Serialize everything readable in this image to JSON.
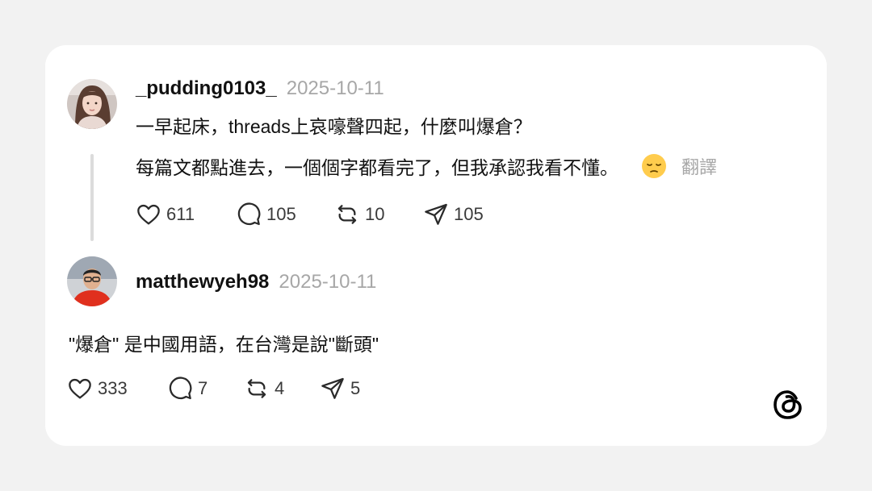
{
  "post1": {
    "username": "_pudding0103_",
    "timestamp": "2025-10-11",
    "line1": "一早起床，threads上哀嚎聲四起，什麼叫爆倉？",
    "line2": "每篇文都點進去，一個個字都看完了，但我承認我看不懂。",
    "emoji_icon": "pensive-face-icon",
    "translate_label": "翻譯",
    "likes": "611",
    "replies": "105",
    "reposts": "10",
    "shares": "105"
  },
  "post2": {
    "username": "matthewyeh98",
    "timestamp": "2025-10-11",
    "text": "\"爆倉\" 是中國用語，在台灣是說\"斷頭\"",
    "likes": "333",
    "replies": "7",
    "reposts": "4",
    "shares": "5"
  },
  "icons": {
    "like": "heart-icon",
    "reply": "comment-bubble-icon",
    "repost": "repost-icon",
    "share": "send-icon",
    "brand": "threads-logo-icon"
  },
  "colors": {
    "background": "#f2f2f2",
    "card": "#ffffff",
    "muted_text": "#a7a7a7",
    "thread_line": "#dcdcdc"
  }
}
